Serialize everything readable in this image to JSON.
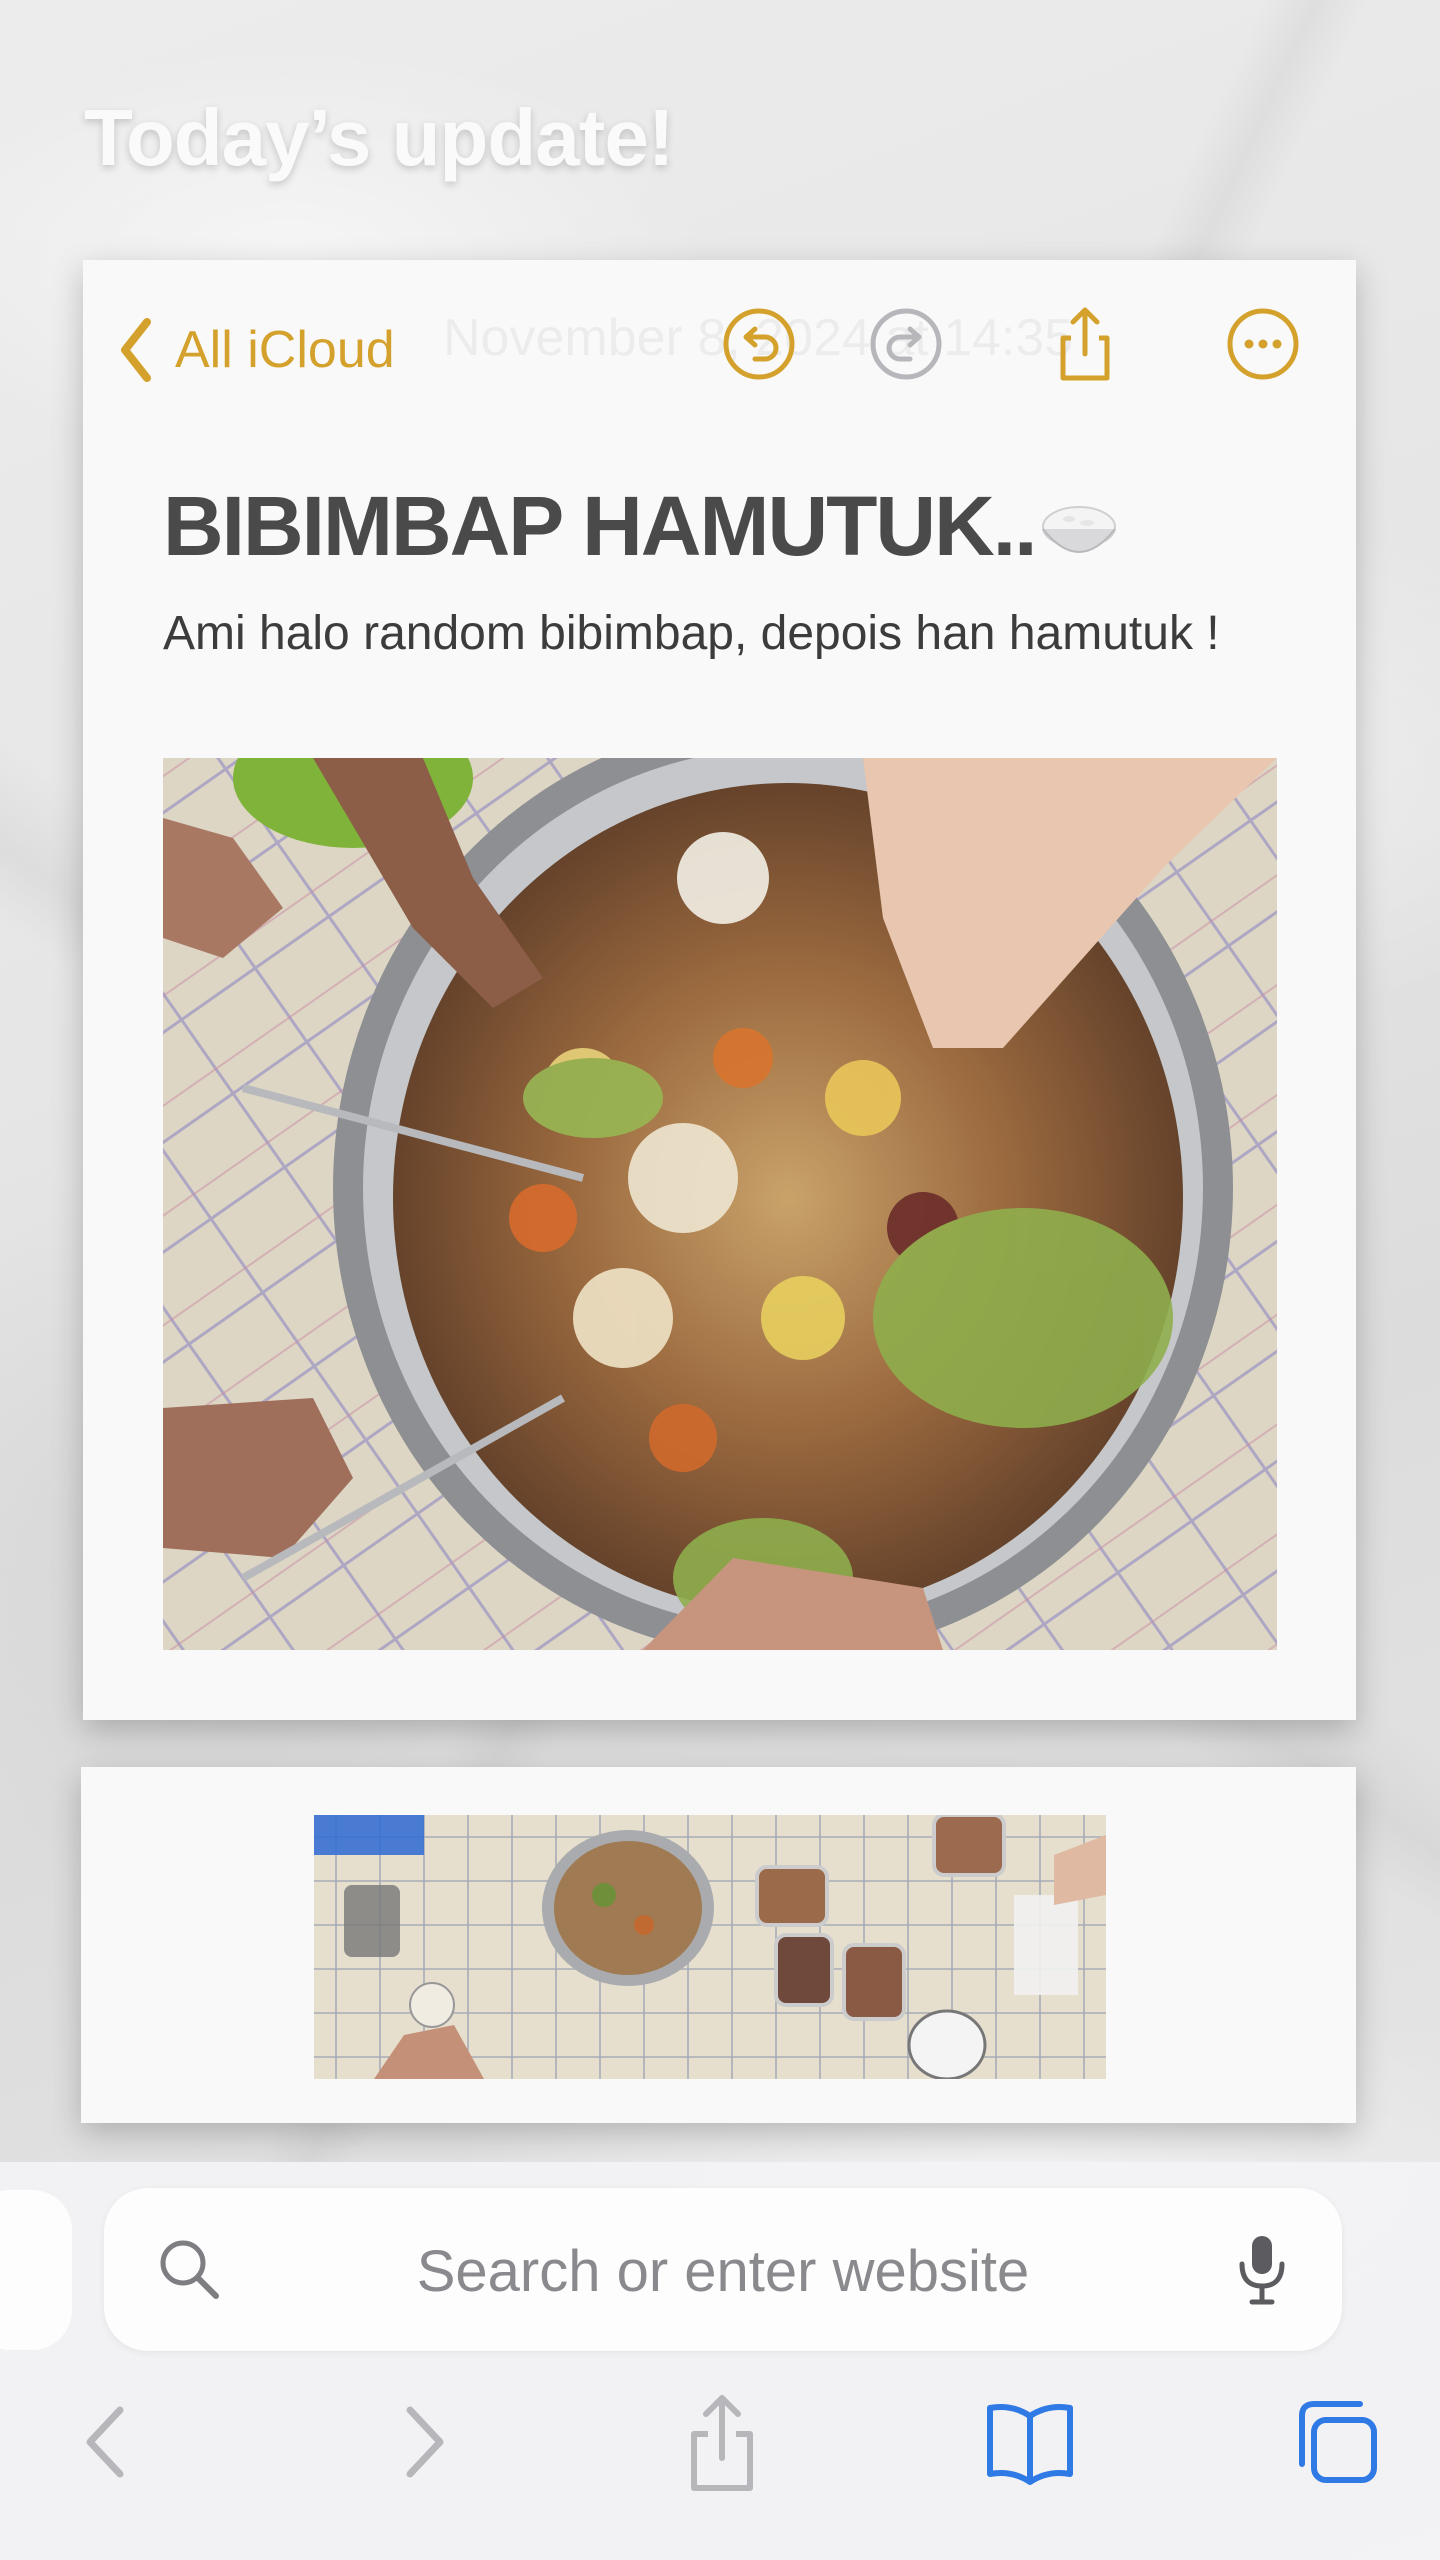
{
  "headline": "Today’s update!",
  "note": {
    "back_label": "All iCloud",
    "date_faint": "November 8, 2024 at 14:35",
    "title": "BIBIMBAP HAMUTUK..",
    "body": "Ami halo random bibimbap, depois han hamutuk !"
  },
  "toolbar_icons": [
    "chevron-left-icon",
    "undo-icon",
    "redo-icon",
    "share-icon",
    "more-icon"
  ],
  "browser": {
    "search_placeholder": "Search or enter website",
    "nav_icons": [
      "back-icon",
      "forward-icon",
      "share-icon",
      "bookmarks-icon",
      "tabs-icon"
    ]
  },
  "colors": {
    "accent": "#d4a22c",
    "safari_blue": "#2f7ae5",
    "disabled": "#b7b7bb"
  }
}
